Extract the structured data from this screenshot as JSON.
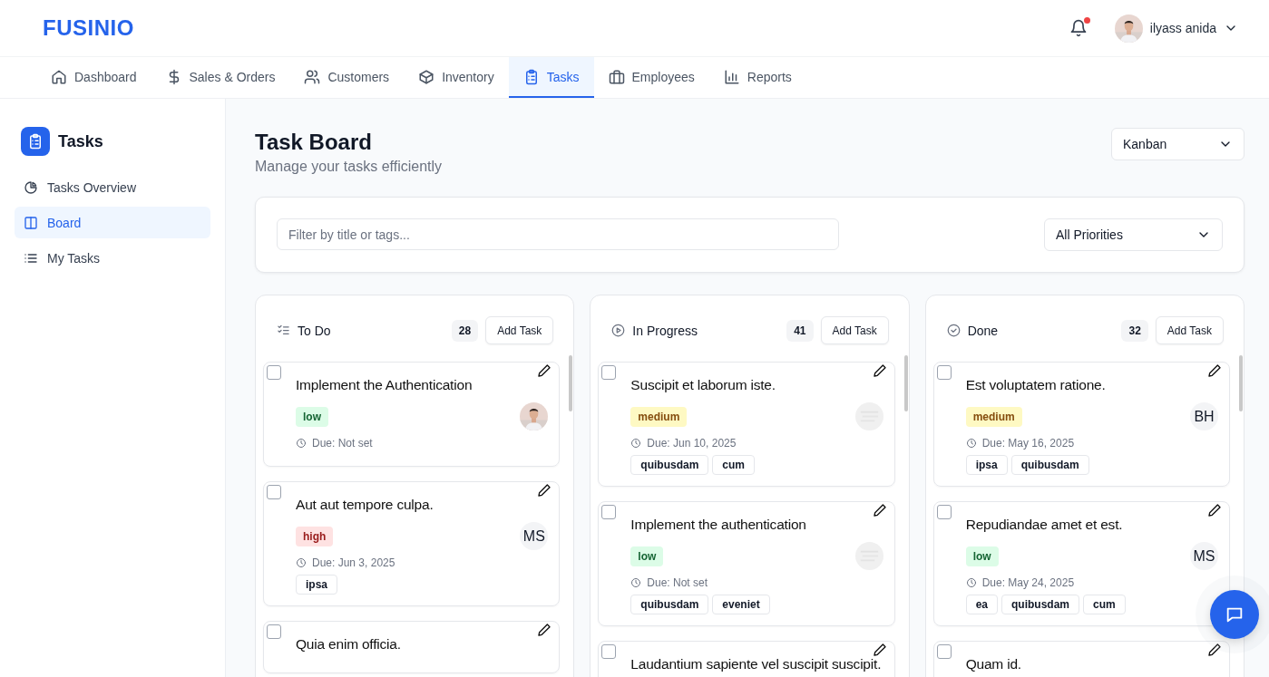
{
  "brand": "FUSINIO",
  "header": {
    "user_name": "ilyass anida",
    "notifications": {
      "unread": true
    }
  },
  "nav": [
    {
      "label": "Dashboard",
      "selected": false
    },
    {
      "label": "Sales & Orders",
      "selected": false
    },
    {
      "label": "Customers",
      "selected": false
    },
    {
      "label": "Inventory",
      "selected": false
    },
    {
      "label": "Tasks",
      "selected": true
    },
    {
      "label": "Employees",
      "selected": false
    },
    {
      "label": "Reports",
      "selected": false
    }
  ],
  "sidebar": {
    "title": "Tasks",
    "items": [
      {
        "label": "Tasks Overview",
        "selected": false
      },
      {
        "label": "Board",
        "selected": true
      },
      {
        "label": "My Tasks",
        "selected": false
      }
    ]
  },
  "page": {
    "title": "Task Board",
    "subtitle": "Manage your tasks efficiently",
    "view": "Kanban"
  },
  "filters": {
    "search_placeholder": "Filter by title or tags...",
    "priority": "All Priorities"
  },
  "columns": [
    {
      "title": "To Do",
      "count": "28",
      "add_label": "Add Task",
      "cards": [
        {
          "title": "Implement the Authentication",
          "priority": "low",
          "due": "Due: Not set",
          "checked": false
        },
        {
          "title": "Aut aut tempore culpa.",
          "priority": "high",
          "avatar": {
            "kind": "initials",
            "text": "MS"
          },
          "due": "Due: Jun 3, 2025",
          "tags": [
            "ipsa"
          ],
          "checked": false
        },
        {
          "title": "Quia enim officia.",
          "checked": false
        }
      ]
    },
    {
      "title": "In Progress",
      "count": "41",
      "add_label": "Add Task",
      "cards": [
        {
          "title": "Suscipit et laborum iste.",
          "priority": "medium",
          "avatar": {
            "kind": "blank"
          },
          "due": "Due: Jun 10, 2025",
          "tags": [
            "quibusdam",
            "cum"
          ],
          "checked": false
        },
        {
          "title": "Implement the authentication",
          "priority": "low",
          "avatar": {
            "kind": "blank"
          },
          "due": "Due: Not set",
          "tags": [
            "quibusdam",
            "eveniet"
          ],
          "checked": false
        },
        {
          "title": "Laudantium sapiente vel suscipit suscipit.",
          "checked": false
        }
      ]
    },
    {
      "title": "Done",
      "count": "32",
      "add_label": "Add Task",
      "cards": [
        {
          "title": "Est voluptatem ratione.",
          "priority": "medium",
          "avatar": {
            "kind": "initials",
            "text": "BH"
          },
          "due": "Due: May 16, 2025",
          "tags": [
            "ipsa",
            "quibusdam"
          ],
          "checked": false
        },
        {
          "title": "Repudiandae amet et est.",
          "priority": "low",
          "avatar": {
            "kind": "initials",
            "text": "MS"
          },
          "due": "Due: May 24, 2025",
          "tags": [
            "ea",
            "quibusdam",
            "cum"
          ],
          "checked": false
        },
        {
          "title": "Quam id.",
          "checked": false
        }
      ]
    }
  ]
}
